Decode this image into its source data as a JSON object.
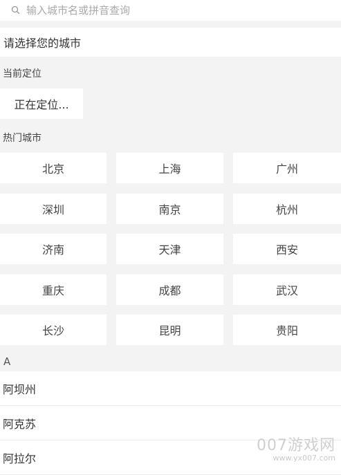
{
  "search": {
    "placeholder": "输入城市名或拼音查询",
    "icon": "search-icon"
  },
  "prompt": "请选择您的城市",
  "current_location": {
    "label": "当前定位",
    "status": "正在定位..."
  },
  "hot_cities": {
    "label": "热门城市",
    "cities": [
      "北京",
      "上海",
      "广州",
      "深圳",
      "南京",
      "杭州",
      "济南",
      "天津",
      "西安",
      "重庆",
      "成都",
      "武汉",
      "长沙",
      "昆明",
      "贵阳"
    ]
  },
  "index": {
    "letter": "A",
    "cities": [
      "阿坝州",
      "阿克苏",
      "阿拉尔"
    ]
  },
  "watermark": {
    "line1": "007游戏网",
    "line2": "www.yx007.com"
  }
}
